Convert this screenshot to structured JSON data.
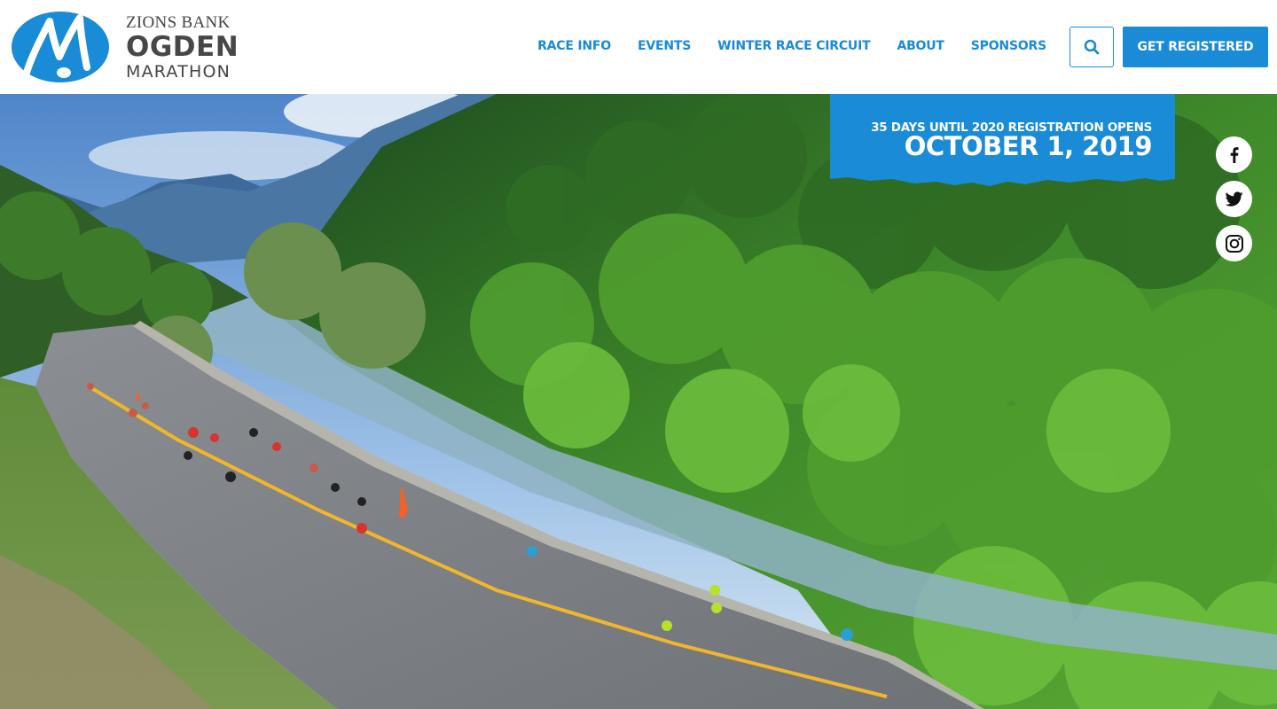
{
  "brand": {
    "line1": "ZIONS BANK",
    "line2": "OGDEN",
    "line3": "MARATHON",
    "primary_color": "#1a8bd6"
  },
  "nav": {
    "items": [
      {
        "label": "RACE INFO"
      },
      {
        "label": "EVENTS"
      },
      {
        "label": "WINTER RACE CIRCUIT"
      },
      {
        "label": "ABOUT"
      },
      {
        "label": "SPONSORS"
      }
    ],
    "search_icon": "search-icon",
    "register_label": "GET REGISTERED"
  },
  "hero": {
    "countdown_line1": "35 DAYS UNTIL 2020 REGISTRATION OPENS",
    "countdown_line2": "OCTOBER 1, 2019",
    "social": [
      {
        "icon": "facebook-icon"
      },
      {
        "icon": "twitter-icon"
      },
      {
        "icon": "instagram-icon"
      }
    ]
  }
}
